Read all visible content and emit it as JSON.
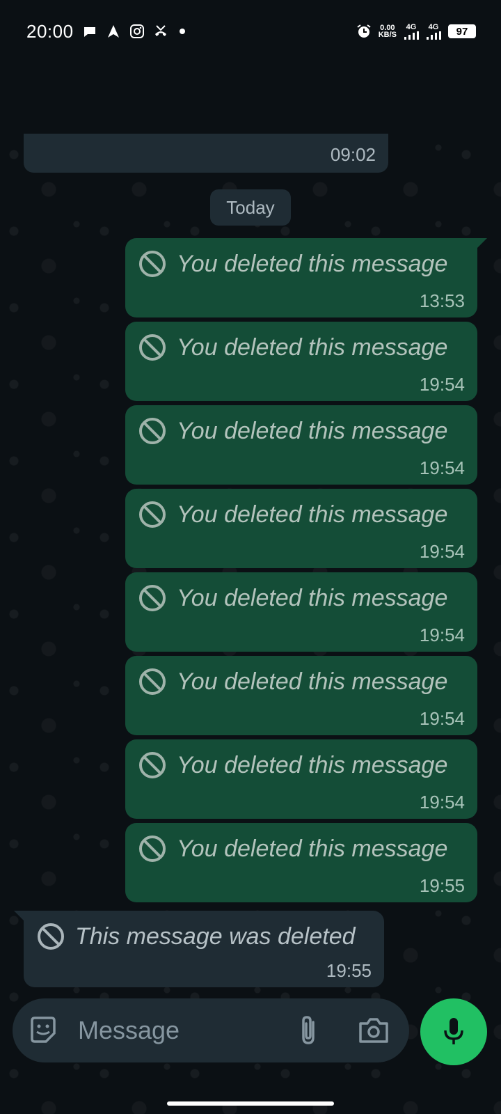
{
  "status_bar": {
    "time": "20:00",
    "net_speed": "0.00",
    "net_unit": "KB/S",
    "sim1": "4G",
    "sim2": "4G",
    "battery": "97"
  },
  "chat": {
    "prev_message_time": "09:02",
    "day_separator": "Today",
    "outgoing": [
      {
        "text": "You deleted this message",
        "time": "13:53"
      },
      {
        "text": "You deleted this message",
        "time": "19:54"
      },
      {
        "text": "You deleted this message",
        "time": "19:54"
      },
      {
        "text": "You deleted this message",
        "time": "19:54"
      },
      {
        "text": "You deleted this message",
        "time": "19:54"
      },
      {
        "text": "You deleted this message",
        "time": "19:54"
      },
      {
        "text": "You deleted this message",
        "time": "19:54"
      },
      {
        "text": "You deleted this message",
        "time": "19:55"
      }
    ],
    "incoming": {
      "text": "This message was deleted",
      "time": "19:55"
    }
  },
  "composer": {
    "placeholder": "Message"
  },
  "colors": {
    "background": "#0b1014",
    "outgoing_bubble": "#144d37",
    "incoming_bubble": "#1f2c34",
    "mic_button": "#21c063"
  }
}
